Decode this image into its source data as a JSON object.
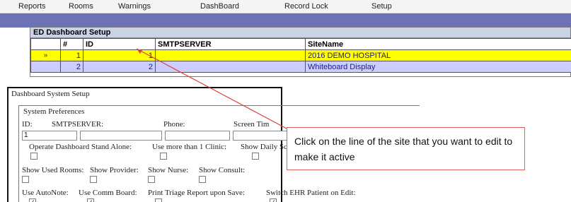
{
  "menu": {
    "items": [
      "Reports",
      "Rooms",
      "Warnings",
      "DashBoard",
      "Record Lock",
      "Setup"
    ]
  },
  "grid": {
    "title": "ED Dashboard Setup",
    "columns": [
      "",
      "#",
      "ID",
      "SMTPSERVER",
      "SiteName"
    ],
    "rows": [
      {
        "indicator": "»",
        "num": "1",
        "id": "1",
        "smtp": "",
        "site": "2016 DEMO HOSPITAL",
        "selected": true
      },
      {
        "indicator": "",
        "num": "2",
        "id": "2",
        "smtp": "",
        "site": "Whiteboard Display",
        "selected": false
      }
    ]
  },
  "setup": {
    "title": "Dashboard System Setup",
    "group_title": "System Preferences",
    "labels": {
      "id": "ID:",
      "smtp": "SMTPSERVER:",
      "phone": "Phone:",
      "screen": "Screen Tim",
      "standalone": "Operate Dashboard Stand Alone:",
      "multiclinic": "Use more than 1 Clinic:",
      "showdaily": "Show Daily Sc",
      "usedrooms": "Show Used Rooms:",
      "provider": "Show Provider:",
      "nurse": "Show Nurse:",
      "consult": "Show Consult:",
      "autonote": "Use AutoNote:",
      "commboard": "Use Comm Board:",
      "printtriage": "Print Triage Report upon Save:",
      "switchehr": "Switch EHR Patient on Edit:"
    },
    "values": {
      "id": "1"
    },
    "check_mark": "✓"
  },
  "callout": {
    "text": "Click on the line of the site that you want to edit to make it active"
  },
  "colors": {
    "selected_row": "#ffff00",
    "normal_row": "#ccccff",
    "menu_strip": "#6b72b5",
    "callout_border": "#e06060"
  }
}
